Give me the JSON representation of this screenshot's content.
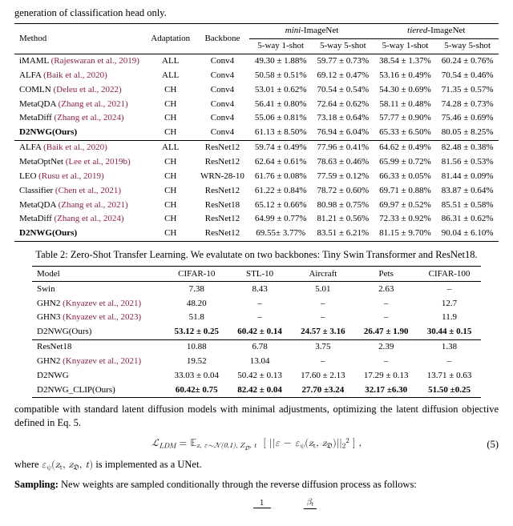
{
  "top_fragment": "generation of classification head only.",
  "table1": {
    "head": {
      "method": "Method",
      "adapt": "Adaptation",
      "backbone": "Backbone",
      "mini": "mini-ImageNet",
      "tiered": "tiered-ImageNet",
      "c1": "5-way 1-shot",
      "c2": "5-way 5-shot"
    },
    "topRows": [
      {
        "m": "iMAML ",
        "cite": "(Rajeswaran et al., 2019)",
        "a": "ALL",
        "b": "Conv4",
        "v": [
          "49.30 ± 1.88%",
          "59.77 ± 0.73%",
          "38.54 ± 1.37%",
          "60.24 ± 0.76%"
        ]
      },
      {
        "m": "ALFA ",
        "cite": "(Baik et al., 2020)",
        "a": "ALL",
        "b": "Conv4",
        "v": [
          "50.58 ± 0.51%",
          "69.12 ± 0.47%",
          "53.16 ± 0.49%",
          "70.54 ± 0.46%"
        ]
      },
      {
        "m": "COMLN ",
        "cite": "(Deleu et al., 2022)",
        "a": "CH",
        "b": "Conv4",
        "v": [
          "53.01 ± 0.62%",
          "70.54 ± 0.54%",
          "54.30 ± 0.69%",
          "71.35 ± 0.57%"
        ]
      },
      {
        "m": "MetaQDA ",
        "cite": "(Zhang et al., 2021)",
        "a": "CH",
        "b": "Conv4",
        "v": [
          "56.41 ± 0.80%",
          "72.64 ± 0.62%",
          "58.11 ± 0.48%",
          "74.28 ± 0.73%"
        ]
      },
      {
        "m": "MetaDiff ",
        "cite": "(Zhang et al., 2024)",
        "a": "CH",
        "b": "Conv4",
        "v": [
          "55.06 ± 0.81%",
          "73.18 ± 0.64%",
          "57.77 ± 0.90%",
          "75.46 ± 0.69%"
        ]
      },
      {
        "m": "D2NWG(Ours)",
        "cite": "",
        "a": "CH",
        "b": "Conv4",
        "v": [
          "61.13 ± 8.50%",
          "76.94 ± 6.04%",
          "65.33 ± 6.50%",
          "80.05 ± 8.25%"
        ],
        "bold": true
      }
    ],
    "botRows": [
      {
        "m": "ALFA ",
        "cite": "(Baik et al., 2020)",
        "a": "ALL",
        "b": "ResNet12",
        "v": [
          "59.74 ± 0.49%",
          "77.96 ± 0.41%",
          "64.62 ± 0.49%",
          "82.48 ± 0.38%"
        ]
      },
      {
        "m": "MetaOptNet ",
        "cite": "(Lee et al., 2019b)",
        "a": "CH",
        "b": "ResNet12",
        "v": [
          "62.64 ± 0.61%",
          "78.63 ± 0.46%",
          "65.99 ± 0.72%",
          "81.56 ± 0.53%"
        ]
      },
      {
        "m": "LEO ",
        "cite": "(Rusu et al., 2019)",
        "a": "CH",
        "b": "WRN-28-10",
        "v": [
          "61.76 ± 0.08%",
          "77.59 ± 0.12%",
          "66.33 ± 0.05%",
          "81.44 ± 0.09%"
        ]
      },
      {
        "m": "Classifier ",
        "cite": "(Chen et al., 2021)",
        "a": "CH",
        "b": "ResNet12",
        "v": [
          "61.22 ± 0.84%",
          "78.72 ± 0.60%",
          "69.71 ± 0.88%",
          "83.87 ± 0.64%"
        ]
      },
      {
        "m": "MetaQDA ",
        "cite": "(Zhang et al., 2021)",
        "a": "CH",
        "b": "ResNet18",
        "v": [
          "65.12 ± 0.66%",
          "80.98 ± 0.75%",
          "69.97 ± 0.52%",
          "85.51 ± 0.58%"
        ]
      },
      {
        "m": "MetaDiff ",
        "cite": "(Zhang et al., 2024)",
        "a": "CH",
        "b": "ResNet12",
        "v": [
          "64.99 ± 0.77%",
          "81.21 ± 0.56%",
          "72.33 ± 0.92%",
          "86.31 ± 0.62%"
        ]
      },
      {
        "m": "D2NWG(Ours)",
        "cite": "",
        "a": "CH",
        "b": "ResNet12",
        "v": [
          "69.55± 3.77%",
          "83.51 ± 6.21%",
          "81.15 ± 9.70%",
          "90.04 ± 6.10%"
        ],
        "bold": true
      }
    ]
  },
  "caption2": "Table 2: Zero-Shot Transfer Learning. We evalutate on two backbones: Tiny Swin Transformer and ResNet18.",
  "table2": {
    "head": [
      "Model",
      "CIFAR-10",
      "STL-10",
      "Aircraft",
      "Pets",
      "CIFAR-100"
    ],
    "topRows": [
      {
        "m": "Swin",
        "cite": "",
        "v": [
          "7.38",
          "8.43",
          "5.01",
          "2.63",
          "–"
        ]
      },
      {
        "m": "GHN2 ",
        "cite": "(Knyazev et al., 2021)",
        "v": [
          "48.20",
          "–",
          "–",
          "–",
          "12.7"
        ]
      },
      {
        "m": "GHN3 ",
        "cite": "(Knyazev et al., 2023)",
        "v": [
          "51.8",
          "–",
          "–",
          "–",
          "11.9"
        ]
      },
      {
        "m": "D2NWG(Ours)",
        "cite": "",
        "v": [
          "53.12 ± 0.25",
          "60.42 ± 0.14",
          "24.57 ± 3.16",
          "26.47 ± 1.90",
          "30.44 ± 0.15"
        ],
        "bold": true
      }
    ],
    "botRows": [
      {
        "m": "ResNet18",
        "cite": "",
        "v": [
          "10.88",
          "6.78",
          "3.75",
          "2.39",
          "1.38"
        ]
      },
      {
        "m": "GHN2 ",
        "cite": "(Knyazev et al., 2021)",
        "v": [
          "19.52",
          "13.04",
          "–",
          "–",
          "–"
        ]
      },
      {
        "m": "D2NWG",
        "cite": "",
        "v": [
          "33.03 ± 0.04",
          "50.42 ± 0.13",
          "17.60 ± 2.13",
          "17.29 ± 0.13",
          "13.71 ± 0.63"
        ]
      },
      {
        "m": "D2NWG_CLIP(Ours)",
        "cite": "",
        "v": [
          "60.42± 0.75",
          "82.42 ± 0.04",
          "27.70 ±3.24",
          "32.17 ±6.30",
          "51.50 ±0.25"
        ],
        "bold": true
      }
    ]
  },
  "para": "compatible with standard latent diffusion models with minimal adjustments, optimizing the latent diffusion objective defined in Eq. 5.",
  "eq_num": "(5)",
  "unet_sentence_pre": "where ",
  "unet_sentence_post": " is implemented as a UNet.",
  "sampling_label": "Sampling:",
  "sampling_text": " New weights are sampled conditionally through the reverse diffusion process as follows:",
  "chart_data": [
    {
      "type": "table",
      "title": "Few-shot classification accuracy (%) on mini-ImageNet and tiered-ImageNet",
      "column_groups": [
        "mini-ImageNet",
        "tiered-ImageNet"
      ],
      "columns": [
        "Method",
        "Adaptation",
        "Backbone",
        "mini 5-way 1-shot",
        "mini 5-way 5-shot",
        "tiered 5-way 1-shot",
        "tiered 5-way 5-shot"
      ],
      "rows_block1": [
        [
          "iMAML",
          "ALL",
          "Conv4",
          "49.30 ± 1.88",
          "59.77 ± 0.73",
          "38.54 ± 1.37",
          "60.24 ± 0.76"
        ],
        [
          "ALFA",
          "ALL",
          "Conv4",
          "50.58 ± 0.51",
          "69.12 ± 0.47",
          "53.16 ± 0.49",
          "70.54 ± 0.46"
        ],
        [
          "COMLN",
          "CH",
          "Conv4",
          "53.01 ± 0.62",
          "70.54 ± 0.54",
          "54.30 ± 0.69",
          "71.35 ± 0.57"
        ],
        [
          "MetaQDA",
          "CH",
          "Conv4",
          "56.41 ± 0.80",
          "72.64 ± 0.62",
          "58.11 ± 0.48",
          "74.28 ± 0.73"
        ],
        [
          "MetaDiff",
          "CH",
          "Conv4",
          "55.06 ± 0.81",
          "73.18 ± 0.64",
          "57.77 ± 0.90",
          "75.46 ± 0.69"
        ],
        [
          "D2NWG(Ours)",
          "CH",
          "Conv4",
          "61.13 ± 8.50",
          "76.94 ± 6.04",
          "65.33 ± 6.50",
          "80.05 ± 8.25"
        ]
      ],
      "rows_block2": [
        [
          "ALFA",
          "ALL",
          "ResNet12",
          "59.74 ± 0.49",
          "77.96 ± 0.41",
          "64.62 ± 0.49",
          "82.48 ± 0.38"
        ],
        [
          "MetaOptNet",
          "CH",
          "ResNet12",
          "62.64 ± 0.61",
          "78.63 ± 0.46",
          "65.99 ± 0.72",
          "81.56 ± 0.53"
        ],
        [
          "LEO",
          "CH",
          "WRN-28-10",
          "61.76 ± 0.08",
          "77.59 ± 0.12",
          "66.33 ± 0.05",
          "81.44 ± 0.09"
        ],
        [
          "Classifier",
          "CH",
          "ResNet12",
          "61.22 ± 0.84",
          "78.72 ± 0.60",
          "69.71 ± 0.88",
          "83.87 ± 0.64"
        ],
        [
          "MetaQDA",
          "CH",
          "ResNet18",
          "65.12 ± 0.66",
          "80.98 ± 0.75",
          "69.97 ± 0.52",
          "85.51 ± 0.58"
        ],
        [
          "MetaDiff",
          "CH",
          "ResNet12",
          "64.99 ± 0.77",
          "81.21 ± 0.56",
          "72.33 ± 0.92",
          "86.31 ± 0.62"
        ],
        [
          "D2NWG(Ours)",
          "CH",
          "ResNet12",
          "69.55 ± 3.77",
          "83.51 ± 6.21",
          "81.15 ± 9.70",
          "90.04 ± 6.10"
        ]
      ]
    },
    {
      "type": "table",
      "title": "Zero-Shot Transfer Learning (accuracy %)",
      "columns": [
        "Model",
        "CIFAR-10",
        "STL-10",
        "Aircraft",
        "Pets",
        "CIFAR-100"
      ],
      "rows_block1": [
        [
          "Swin",
          "7.38",
          "8.43",
          "5.01",
          "2.63",
          "–"
        ],
        [
          "GHN2",
          "48.20",
          "–",
          "–",
          "–",
          "12.7"
        ],
        [
          "GHN3",
          "51.8",
          "–",
          "–",
          "–",
          "11.9"
        ],
        [
          "D2NWG(Ours)",
          "53.12 ± 0.25",
          "60.42 ± 0.14",
          "24.57 ± 3.16",
          "26.47 ± 1.90",
          "30.44 ± 0.15"
        ]
      ],
      "rows_block2": [
        [
          "ResNet18",
          "10.88",
          "6.78",
          "3.75",
          "2.39",
          "1.38"
        ],
        [
          "GHN2",
          "19.52",
          "13.04",
          "–",
          "–",
          "–"
        ],
        [
          "D2NWG",
          "33.03 ± 0.04",
          "50.42 ± 0.13",
          "17.60 ± 2.13",
          "17.29 ± 0.13",
          "13.71 ± 0.63"
        ],
        [
          "D2NWG_CLIP(Ours)",
          "60.42 ± 0.75",
          "82.42 ± 0.04",
          "27.70 ± 3.24",
          "32.17 ± 6.30",
          "51.50 ± 0.25"
        ]
      ]
    }
  ]
}
